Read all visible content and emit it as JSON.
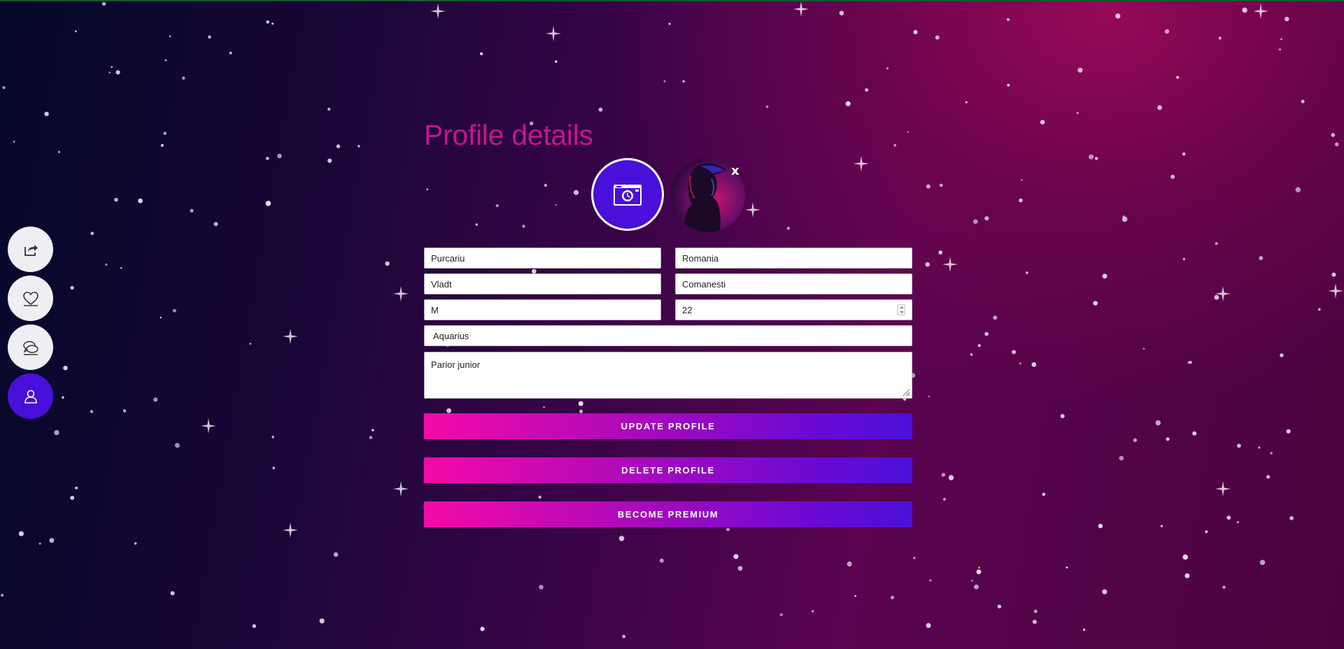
{
  "page": {
    "title": "Profile details",
    "accent_color": "#c3168c",
    "primary_color": "#4a0fd8"
  },
  "sidebar": {
    "items": [
      {
        "icon": "share-icon",
        "active": false
      },
      {
        "icon": "heart-icon",
        "active": false
      },
      {
        "icon": "chat-icon",
        "active": false
      },
      {
        "icon": "user-icon",
        "active": true
      }
    ]
  },
  "photos": {
    "upload_icon": "camera-icon",
    "close_label": "x"
  },
  "form": {
    "last_name": "Purcariu",
    "country": "Romania",
    "first_name": "Vladt",
    "city": "Comanesti",
    "gender": "M",
    "age": "22",
    "zodiac": "Aquarius",
    "bio": "Parior junior"
  },
  "buttons": {
    "update": "UPDATE PROFILE",
    "delete": "DELETE PROFILE",
    "premium": "BECOME PREMIUM"
  }
}
